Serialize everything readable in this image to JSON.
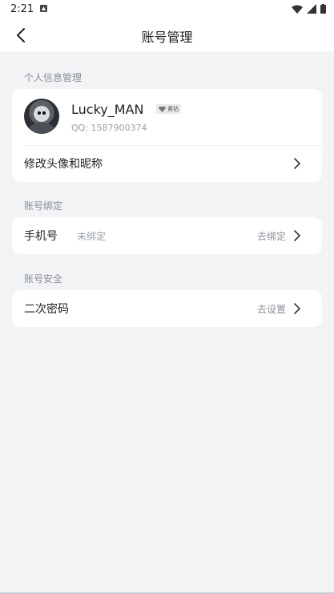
{
  "status_bar": {
    "time": "2:21",
    "icons": [
      "app-icon",
      "wifi-icon",
      "signal-icon",
      "battery-icon"
    ]
  },
  "nav": {
    "title": "账号管理",
    "back_icon": "chevron-left-icon"
  },
  "sections": {
    "personal": {
      "label": "个人信息管理",
      "profile": {
        "username": "Lucky_MAN",
        "badge": "黄钻",
        "qq": "QQ: 1587900374"
      },
      "edit_row": {
        "label": "修改头像和昵称"
      }
    },
    "binding": {
      "label": "账号绑定",
      "phone_row": {
        "label": "手机号",
        "value": "未绑定",
        "action": "去绑定"
      }
    },
    "security": {
      "label": "账号安全",
      "password_row": {
        "label": "二次密码",
        "action": "去设置"
      }
    }
  },
  "colors": {
    "background": "#f2f3f5",
    "card": "#ffffff",
    "muted_text": "#9aa0a6"
  }
}
